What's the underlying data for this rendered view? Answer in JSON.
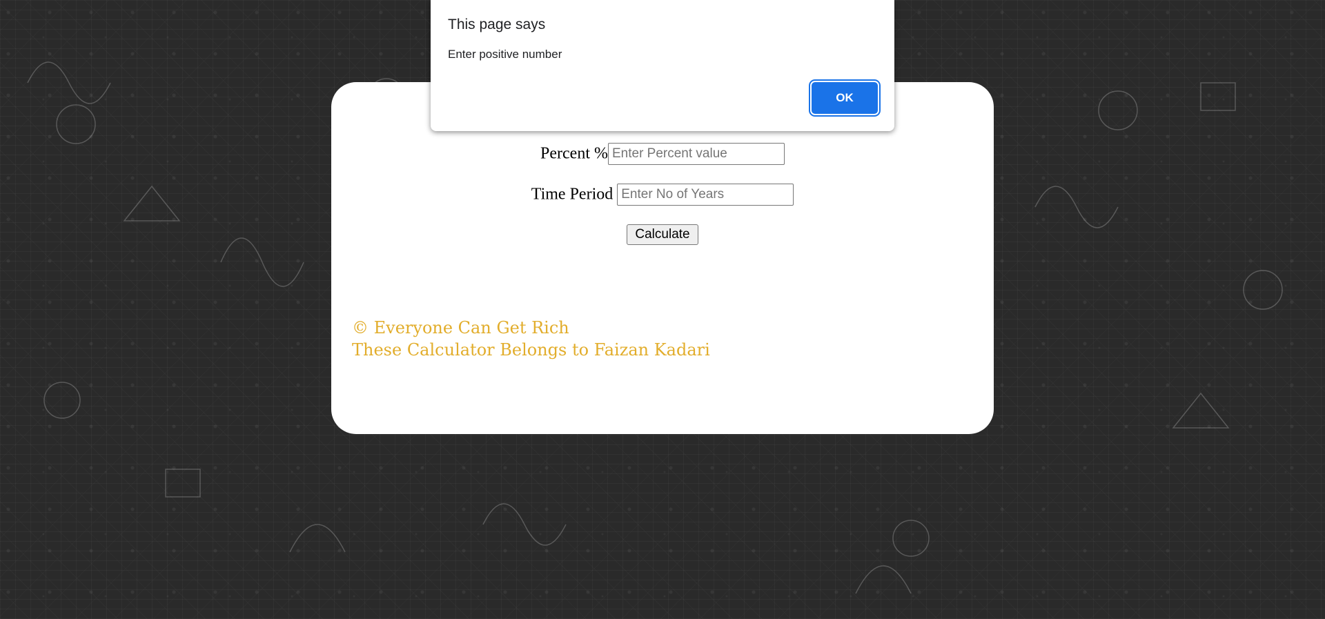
{
  "dialog": {
    "title": "This page says",
    "message": "Enter positive number",
    "ok_label": "OK"
  },
  "form": {
    "percent": {
      "label": "Percent %",
      "placeholder": "Enter Percent value",
      "value": ""
    },
    "time_period": {
      "label": "Time Period",
      "placeholder": "Enter No of Years",
      "value": ""
    },
    "calculate_label": "Calculate"
  },
  "footer": {
    "line1": "© Everyone Can Get Rich",
    "line2": "These Calculator Belongs to Faizan Kadari"
  },
  "colors": {
    "accent": "#e2ad2b",
    "dialog_button": "#1a73e8",
    "background": "#2a2a2a"
  }
}
